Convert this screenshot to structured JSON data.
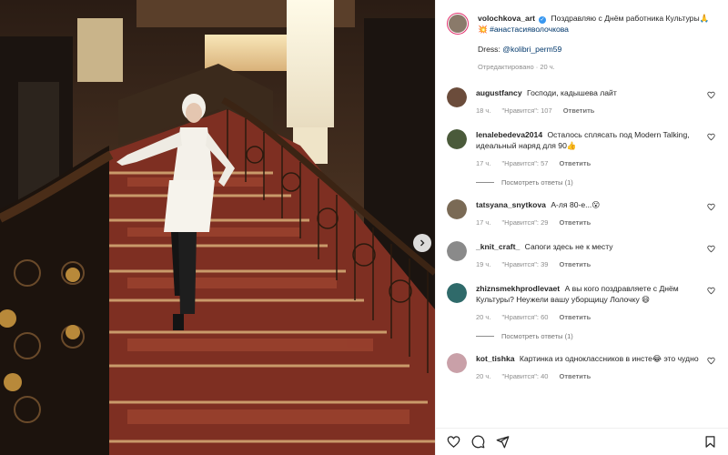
{
  "post": {
    "author": "volochkova_art",
    "caption_text": "Поздравляю с Днём работника Культуры🙏",
    "caption_hashtag_prefix": "💥",
    "caption_hashtag": "#анастасияволочкова",
    "dress_label": "Dress:",
    "dress_mention": "@kolibri_perm59",
    "edited_label": "Отредактировано",
    "edited_time": "20 ч."
  },
  "comments": [
    {
      "user": "augustfancy",
      "text": "Господи, кадышева лайт",
      "time": "18 ч.",
      "likes": "\"Нравится\": 107",
      "reply": "Ответить",
      "avatar_color": "#6b4c3b"
    },
    {
      "user": "lenalebedeva2014",
      "text": "Осталось сплясать под Modern Talking, идеальный наряд для 90👍",
      "time": "17 ч.",
      "likes": "\"Нравится\": 57",
      "reply": "Ответить",
      "avatar_color": "#4a5a3a",
      "view_replies": "Посмотреть ответы (1)"
    },
    {
      "user": "tatsyana_snytkova",
      "text": "А-ля 80-е...😮",
      "time": "17 ч.",
      "likes": "\"Нравится\": 29",
      "reply": "Ответить",
      "avatar_color": "#7a6a55"
    },
    {
      "user": "_knit_craft_",
      "text": "Сапоги здесь не к месту",
      "time": "19 ч.",
      "likes": "\"Нравится\": 39",
      "reply": "Ответить",
      "avatar_color": "#8a8a8a"
    },
    {
      "user": "zhiznsmekhprodlevaet",
      "text": "А вы кого поздравляете с Днём Культуры? Неужели вашу уборщицу Лолочку 😄",
      "time": "20 ч.",
      "likes": "\"Нравится\": 60",
      "reply": "Ответить",
      "avatar_color": "#2f6a6a",
      "view_replies": "Посмотреть ответы (1)"
    },
    {
      "user": "kot_tishka",
      "text": "Картинка из одноклассников в инсте😂 это чудно",
      "time": "20 ч.",
      "likes": "\"Нравится\": 40",
      "reply": "Ответить",
      "avatar_color": "#c9a0a8"
    }
  ],
  "icons": {
    "like": "heart-icon",
    "comment": "comment-icon",
    "share": "share-icon",
    "save": "bookmark-icon",
    "next": "chevron-right-icon"
  },
  "colors": {
    "link": "#00376b",
    "verified": "#3897f0",
    "muted": "#8e8e8e",
    "story_ring": "#e1306c"
  }
}
